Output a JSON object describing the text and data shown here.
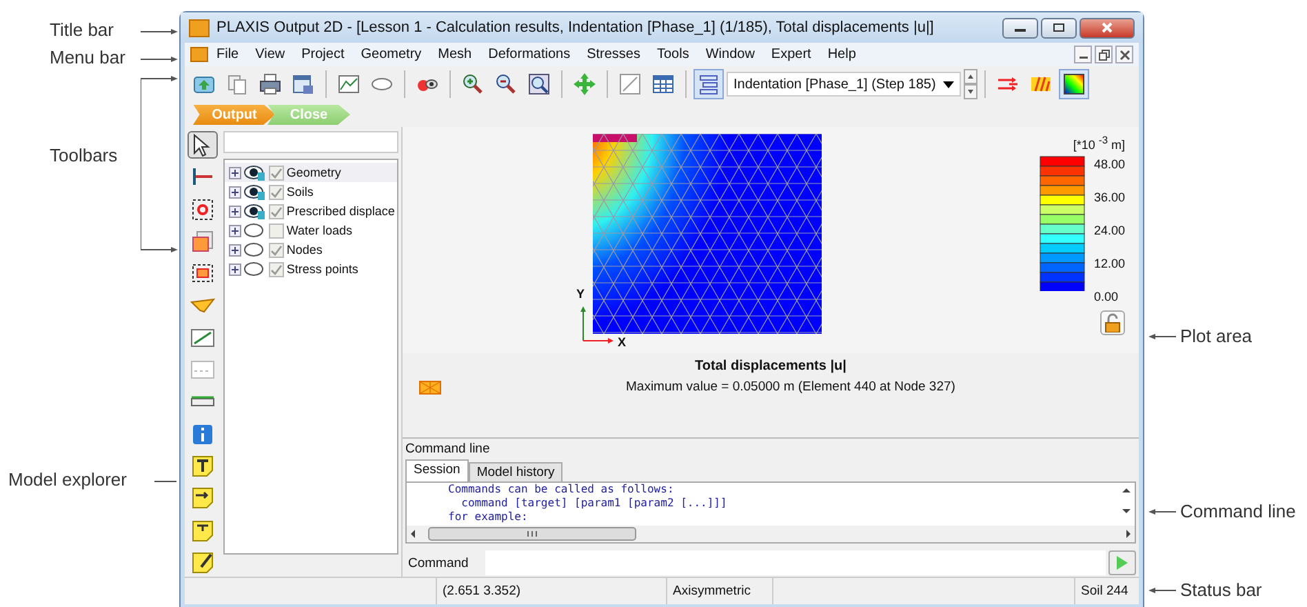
{
  "annotations": {
    "left": [
      {
        "label": "Title bar"
      },
      {
        "label": "Menu bar"
      },
      {
        "label": "Toolbars"
      },
      {
        "label": "Model explorer"
      }
    ],
    "right": [
      {
        "label": "Plot area"
      },
      {
        "label": "Command line"
      },
      {
        "label": "Status bar"
      }
    ]
  },
  "window": {
    "title": "PLAXIS Output 2D - [Lesson 1 - Calculation results, Indentation [Phase_1] (1/185), Total displacements |u|]"
  },
  "menu": [
    "File",
    "View",
    "Project",
    "Geometry",
    "Mesh",
    "Deformations",
    "Stresses",
    "Tools",
    "Window",
    "Expert",
    "Help"
  ],
  "toolbar": {
    "step_select": "Indentation [Phase_1] (Step 185)"
  },
  "flow_tabs": [
    {
      "label": "Output",
      "selected": true
    },
    {
      "label": "Close",
      "selected": false
    }
  ],
  "model_explorer": {
    "items": [
      {
        "label": "Geometry",
        "visible": true,
        "checked": true,
        "highlighted": true
      },
      {
        "label": "Soils",
        "visible": true,
        "checked": true,
        "highlighted": false
      },
      {
        "label": "Prescribed displace",
        "visible": true,
        "checked": true,
        "highlighted": false
      },
      {
        "label": "Water loads",
        "visible": false,
        "checked": false,
        "highlighted": false
      },
      {
        "label": "Nodes",
        "visible": false,
        "checked": true,
        "highlighted": false
      },
      {
        "label": "Stress points",
        "visible": false,
        "checked": true,
        "highlighted": false
      }
    ]
  },
  "plot": {
    "legend_unit": "[*10 $^{-3}$ m]",
    "legend_values": [
      "48.00",
      "36.00",
      "24.00",
      "12.00",
      "0.00"
    ],
    "axis_y": "Y",
    "axis_x": "X",
    "result_title": "Total displacements |u|",
    "max_value": "Maximum value = 0.05000 m (Element 440 at Node 327)"
  },
  "command_line": {
    "title": "Command line",
    "tabs": [
      {
        "label": "Session",
        "selected": true
      },
      {
        "label": "Model history",
        "selected": false
      }
    ],
    "output": [
      "Commands can be called as follows:",
      "  command [target] [param1 [param2 [...]]]",
      "for example:"
    ],
    "command_label": "Command"
  },
  "status_bar": [
    "(2.651 3.352)",
    "Axisymmetric",
    "Soil 244"
  ]
}
